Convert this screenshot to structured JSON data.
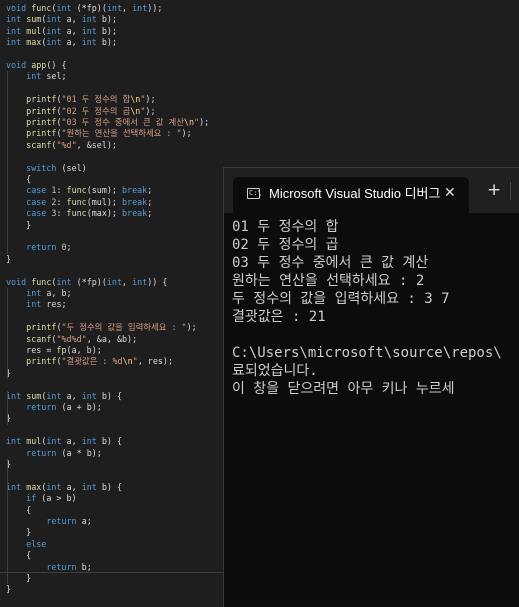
{
  "editor": {
    "colors": {
      "keyword": "#569cd6",
      "function": "#dcdcaa",
      "string": "#d69d85",
      "escape": "#ffd68f",
      "number": "#b5cea8",
      "text": "#dcdcdc"
    },
    "lines": [
      [
        [
          "kw",
          "void"
        ],
        [
          "t",
          " "
        ],
        [
          "fn",
          "func"
        ],
        [
          "t",
          "("
        ],
        [
          "kw",
          "int"
        ],
        [
          "t",
          " (*fp)("
        ],
        [
          "kw",
          "int"
        ],
        [
          "t",
          ", "
        ],
        [
          "kw",
          "int"
        ],
        [
          "t",
          "));"
        ]
      ],
      [
        [
          "kw",
          "int"
        ],
        [
          "t",
          " "
        ],
        [
          "fn",
          "sum"
        ],
        [
          "t",
          "("
        ],
        [
          "kw",
          "int"
        ],
        [
          "t",
          " a, "
        ],
        [
          "kw",
          "int"
        ],
        [
          "t",
          " b);"
        ]
      ],
      [
        [
          "kw",
          "int"
        ],
        [
          "t",
          " "
        ],
        [
          "fn",
          "mul"
        ],
        [
          "t",
          "("
        ],
        [
          "kw",
          "int"
        ],
        [
          "t",
          " a, "
        ],
        [
          "kw",
          "int"
        ],
        [
          "t",
          " b);"
        ]
      ],
      [
        [
          "kw",
          "int"
        ],
        [
          "t",
          " "
        ],
        [
          "fn",
          "max"
        ],
        [
          "t",
          "("
        ],
        [
          "kw",
          "int"
        ],
        [
          "t",
          " a, "
        ],
        [
          "kw",
          "int"
        ],
        [
          "t",
          " b);"
        ]
      ],
      [],
      [
        [
          "kw",
          "void"
        ],
        [
          "t",
          " "
        ],
        [
          "fn",
          "app"
        ],
        [
          "t",
          "() {"
        ]
      ],
      [
        [
          "t",
          "    "
        ],
        [
          "kw",
          "int"
        ],
        [
          "t",
          " sel;"
        ]
      ],
      [],
      [
        [
          "t",
          "    "
        ],
        [
          "fn",
          "printf"
        ],
        [
          "t",
          "("
        ],
        [
          "str",
          "\"01 두 정수의 합"
        ],
        [
          "esc",
          "\\n"
        ],
        [
          "str",
          "\""
        ],
        [
          "t",
          ");"
        ]
      ],
      [
        [
          "t",
          "    "
        ],
        [
          "fn",
          "printf"
        ],
        [
          "t",
          "("
        ],
        [
          "str",
          "\"02 두 정수의 곱"
        ],
        [
          "esc",
          "\\n"
        ],
        [
          "str",
          "\""
        ],
        [
          "t",
          ");"
        ]
      ],
      [
        [
          "t",
          "    "
        ],
        [
          "fn",
          "printf"
        ],
        [
          "t",
          "("
        ],
        [
          "str",
          "\"03 두 정수 중에서 큰 값 계산"
        ],
        [
          "esc",
          "\\n"
        ],
        [
          "str",
          "\""
        ],
        [
          "t",
          ");"
        ]
      ],
      [
        [
          "t",
          "    "
        ],
        [
          "fn",
          "printf"
        ],
        [
          "t",
          "("
        ],
        [
          "str",
          "\"원하는 연산을 선택하세요 : \""
        ],
        [
          "t",
          ");"
        ]
      ],
      [
        [
          "t",
          "    "
        ],
        [
          "fn",
          "scanf"
        ],
        [
          "t",
          "("
        ],
        [
          "str",
          "\"%d\""
        ],
        [
          "t",
          ", &sel);"
        ]
      ],
      [],
      [
        [
          "t",
          "    "
        ],
        [
          "kw",
          "switch"
        ],
        [
          "t",
          " (sel)"
        ]
      ],
      [
        [
          "t",
          "    {"
        ]
      ],
      [
        [
          "t",
          "    "
        ],
        [
          "kw",
          "case"
        ],
        [
          "t",
          " "
        ],
        [
          "num",
          "1"
        ],
        [
          "t",
          ": "
        ],
        [
          "fn",
          "func"
        ],
        [
          "t",
          "(sum); "
        ],
        [
          "kw",
          "break"
        ],
        [
          "t",
          ";"
        ]
      ],
      [
        [
          "t",
          "    "
        ],
        [
          "kw",
          "case"
        ],
        [
          "t",
          " "
        ],
        [
          "num",
          "2"
        ],
        [
          "t",
          ": "
        ],
        [
          "fn",
          "func"
        ],
        [
          "t",
          "(mul); "
        ],
        [
          "kw",
          "break"
        ],
        [
          "t",
          ";"
        ]
      ],
      [
        [
          "t",
          "    "
        ],
        [
          "kw",
          "case"
        ],
        [
          "t",
          " "
        ],
        [
          "num",
          "3"
        ],
        [
          "t",
          ": "
        ],
        [
          "fn",
          "func"
        ],
        [
          "t",
          "(max); "
        ],
        [
          "kw",
          "break"
        ],
        [
          "t",
          ";"
        ]
      ],
      [
        [
          "t",
          "    }"
        ]
      ],
      [],
      [
        [
          "t",
          "    "
        ],
        [
          "kw",
          "return"
        ],
        [
          "t",
          " "
        ],
        [
          "num",
          "0"
        ],
        [
          "t",
          ";"
        ]
      ],
      [
        [
          "t",
          "}"
        ]
      ],
      [],
      [
        [
          "kw",
          "void"
        ],
        [
          "t",
          " "
        ],
        [
          "fn",
          "func"
        ],
        [
          "t",
          "("
        ],
        [
          "kw",
          "int"
        ],
        [
          "t",
          " (*fp)("
        ],
        [
          "kw",
          "int"
        ],
        [
          "t",
          ", "
        ],
        [
          "kw",
          "int"
        ],
        [
          "t",
          ")) {"
        ]
      ],
      [
        [
          "t",
          "    "
        ],
        [
          "kw",
          "int"
        ],
        [
          "t",
          " a, b;"
        ]
      ],
      [
        [
          "t",
          "    "
        ],
        [
          "kw",
          "int"
        ],
        [
          "t",
          " res;"
        ]
      ],
      [],
      [
        [
          "t",
          "    "
        ],
        [
          "fn",
          "printf"
        ],
        [
          "t",
          "("
        ],
        [
          "str",
          "\"두 정수의 값을 입력하세요 : \""
        ],
        [
          "t",
          ");"
        ]
      ],
      [
        [
          "t",
          "    "
        ],
        [
          "fn",
          "scanf"
        ],
        [
          "t",
          "("
        ],
        [
          "str",
          "\"%d%d\""
        ],
        [
          "t",
          ", &a, &b);"
        ]
      ],
      [
        [
          "t",
          "    res = "
        ],
        [
          "fn",
          "fp"
        ],
        [
          "t",
          "(a, b);"
        ]
      ],
      [
        [
          "t",
          "    "
        ],
        [
          "fn",
          "printf"
        ],
        [
          "t",
          "("
        ],
        [
          "str",
          "\"결괏값은 : %d"
        ],
        [
          "esc",
          "\\n"
        ],
        [
          "str",
          "\""
        ],
        [
          "t",
          ", res);"
        ]
      ],
      [
        [
          "t",
          "}"
        ]
      ],
      [],
      [
        [
          "kw",
          "int"
        ],
        [
          "t",
          " "
        ],
        [
          "fn",
          "sum"
        ],
        [
          "t",
          "("
        ],
        [
          "kw",
          "int"
        ],
        [
          "t",
          " a, "
        ],
        [
          "kw",
          "int"
        ],
        [
          "t",
          " b) {"
        ]
      ],
      [
        [
          "t",
          "    "
        ],
        [
          "kw",
          "return"
        ],
        [
          "t",
          " (a + b);"
        ]
      ],
      [
        [
          "t",
          "}"
        ]
      ],
      [],
      [
        [
          "kw",
          "int"
        ],
        [
          "t",
          " "
        ],
        [
          "fn",
          "mul"
        ],
        [
          "t",
          "("
        ],
        [
          "kw",
          "int"
        ],
        [
          "t",
          " a, "
        ],
        [
          "kw",
          "int"
        ],
        [
          "t",
          " b) {"
        ]
      ],
      [
        [
          "t",
          "    "
        ],
        [
          "kw",
          "return"
        ],
        [
          "t",
          " (a * b);"
        ]
      ],
      [
        [
          "t",
          "}"
        ]
      ],
      [],
      [
        [
          "kw",
          "int"
        ],
        [
          "t",
          " "
        ],
        [
          "fn",
          "max"
        ],
        [
          "t",
          "("
        ],
        [
          "kw",
          "int"
        ],
        [
          "t",
          " a, "
        ],
        [
          "kw",
          "int"
        ],
        [
          "t",
          " b) {"
        ]
      ],
      [
        [
          "t",
          "    "
        ],
        [
          "kw",
          "if"
        ],
        [
          "t",
          " (a > b)"
        ]
      ],
      [
        [
          "t",
          "    {"
        ]
      ],
      [
        [
          "t",
          "        "
        ],
        [
          "kw",
          "return"
        ],
        [
          "t",
          " a;"
        ]
      ],
      [
        [
          "t",
          "    }"
        ]
      ],
      [
        [
          "t",
          "    "
        ],
        [
          "kw",
          "else"
        ]
      ],
      [
        [
          "t",
          "    {"
        ]
      ],
      [
        [
          "t",
          "        "
        ],
        [
          "kw",
          "return"
        ],
        [
          "t",
          " b;"
        ]
      ],
      [
        [
          "t",
          "    }"
        ]
      ],
      [
        [
          "t",
          "}"
        ]
      ]
    ]
  },
  "terminal": {
    "tab_title": "Microsoft Visual Studio 디버그",
    "tab_icon": "terminal-icon",
    "tab_icon_glyph": "C:\\",
    "close_glyph": "✕",
    "new_tab_glyph": "+",
    "output": [
      "01 두 정수의 합",
      "02 두 정수의 곱",
      "03 두 정수 중에서 큰 값 계산",
      "원하는 연산을 선택하세요 : 2",
      "두 정수의 값을 입력하세요 : 3 7",
      "결괏값은 : 21",
      "",
      "C:\\Users\\microsoft\\source\\repos\\",
      "료되었습니다.",
      "이 창을 닫으려면 아무 키나 누르세"
    ]
  }
}
